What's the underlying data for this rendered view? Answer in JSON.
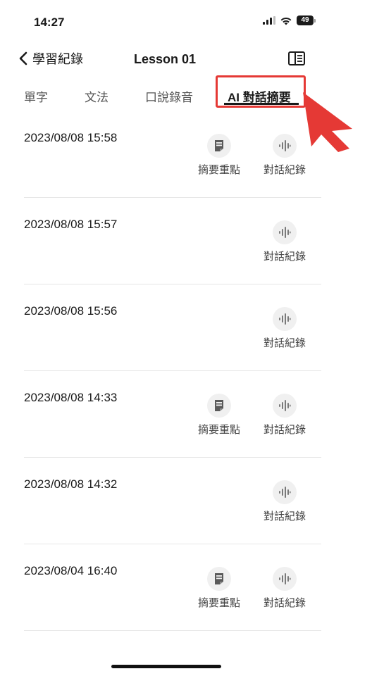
{
  "status_bar": {
    "time": "14:27",
    "battery": "49"
  },
  "nav": {
    "back_label": "學習紀錄",
    "title": "Lesson 01"
  },
  "tabs": [
    {
      "label": "單字"
    },
    {
      "label": "文法"
    },
    {
      "label": "口說錄音"
    },
    {
      "label": "AI 對話摘要",
      "active": true
    }
  ],
  "actions": {
    "summary_label": "摘要重點",
    "record_label": "對話紀錄"
  },
  "records": [
    {
      "datetime": "2023/08/08 15:58",
      "has_summary": true
    },
    {
      "datetime": "2023/08/08 15:57",
      "has_summary": false
    },
    {
      "datetime": "2023/08/08 15:56",
      "has_summary": false
    },
    {
      "datetime": "2023/08/08 14:33",
      "has_summary": true
    },
    {
      "datetime": "2023/08/08 14:32",
      "has_summary": false
    },
    {
      "datetime": "2023/08/04 16:40",
      "has_summary": true
    }
  ],
  "colors": {
    "highlight": "#e53935",
    "icon_bg": "#f0f0f0"
  }
}
